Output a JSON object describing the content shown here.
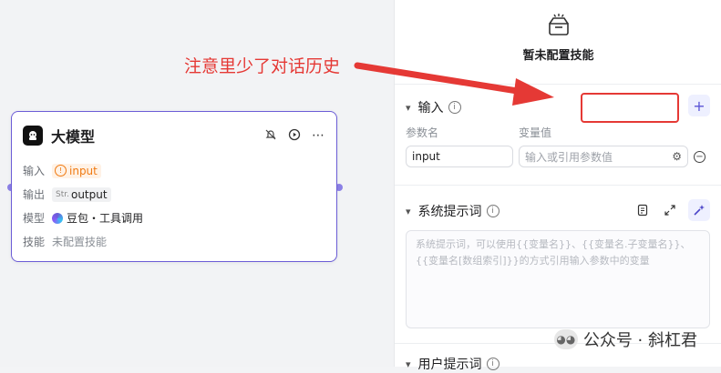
{
  "annotation": {
    "text": "注意里少了对话历史"
  },
  "node": {
    "title": "大模型",
    "rows": [
      {
        "label": "输入",
        "value": "input"
      },
      {
        "label": "输出",
        "type_badge": "Str.",
        "value": "output"
      },
      {
        "label": "模型",
        "value": "豆包・工具调用"
      },
      {
        "label": "技能",
        "value": "未配置技能"
      }
    ]
  },
  "panel": {
    "skill_empty": "暂未配置技能",
    "input_section": {
      "title": "输入",
      "col_param": "参数名",
      "col_value": "变量值",
      "param_value": "input",
      "value_placeholder": "输入或引用参数值"
    },
    "system_prompt": {
      "title": "系统提示词",
      "placeholder_line1": "系统提示词，可以使用{{变量名}}、{{变量名.子变量名}}、",
      "placeholder_line2": "{{变量名[数组索引]}}的方式引用输入参数中的变量"
    },
    "user_prompt": {
      "title": "用户提示词"
    }
  },
  "watermark": {
    "text": "公众号 · 斜杠君"
  },
  "colors": {
    "accent": "#6b5cd6",
    "annotation": "#e53935",
    "input_tag": "#f07a12"
  }
}
